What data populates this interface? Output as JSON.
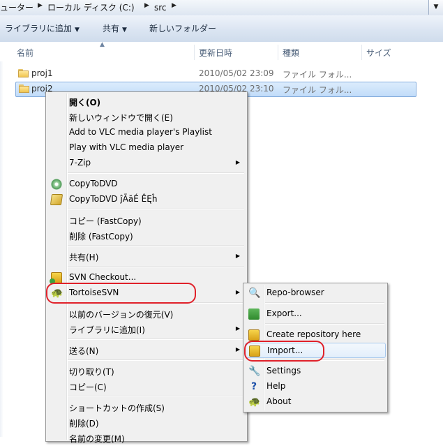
{
  "address_bar": {
    "crumbs": [
      "ューター",
      "ローカル ディスク (C:)",
      "src"
    ],
    "dropdown_icon": "chevron-down-icon"
  },
  "toolbar": {
    "library_label": "ライブラリに追加",
    "share_label": "共有",
    "new_folder_label": "新しいフォルダー"
  },
  "columns": {
    "name": "名前",
    "modified": "更新日時",
    "type": "種類",
    "size": "サイズ"
  },
  "files": [
    {
      "name": "proj1",
      "modified": "2010/05/02 23:09",
      "type": "ファイル フォル..."
    },
    {
      "name": "proj2",
      "modified": "2010/05/02 23:10",
      "type": "ファイル フォル..."
    }
  ],
  "context_menu": {
    "open": "開く(O)",
    "open_new_window": "新しいウィンドウで開く(E)",
    "vlc_playlist": "Add to VLC media player's Playlist",
    "vlc_play": "Play with VLC media player",
    "sevenzip": "7-Zip",
    "copytodvd": "CopyToDVD",
    "copytodvd2": "CopyToDVD ĵÃăÉ ÊĘĥ",
    "fastcopy_copy": "コピー (FastCopy)",
    "fastcopy_delete": "削除 (FastCopy)",
    "share": "共有(H)",
    "svn_checkout": "SVN Checkout...",
    "tortoisesvn": "TortoiseSVN",
    "restore_prev": "以前のバージョンの復元(V)",
    "add_library": "ライブラリに追加(I)",
    "send_to": "送る(N)",
    "cut": "切り取り(T)",
    "copy": "コピー(C)",
    "create_shortcut": "ショートカットの作成(S)",
    "delete": "削除(D)",
    "rename": "名前の変更(M)"
  },
  "svn_submenu": {
    "repo_browser": "Repo-browser",
    "export": "Export...",
    "create_repo": "Create repository here",
    "import": "Import...",
    "settings": "Settings",
    "help": "Help",
    "about": "About"
  },
  "colors": {
    "highlight_ring": "#e0212a",
    "selection": "#c1dcf9",
    "menu_bg": "#f0f0f0"
  }
}
